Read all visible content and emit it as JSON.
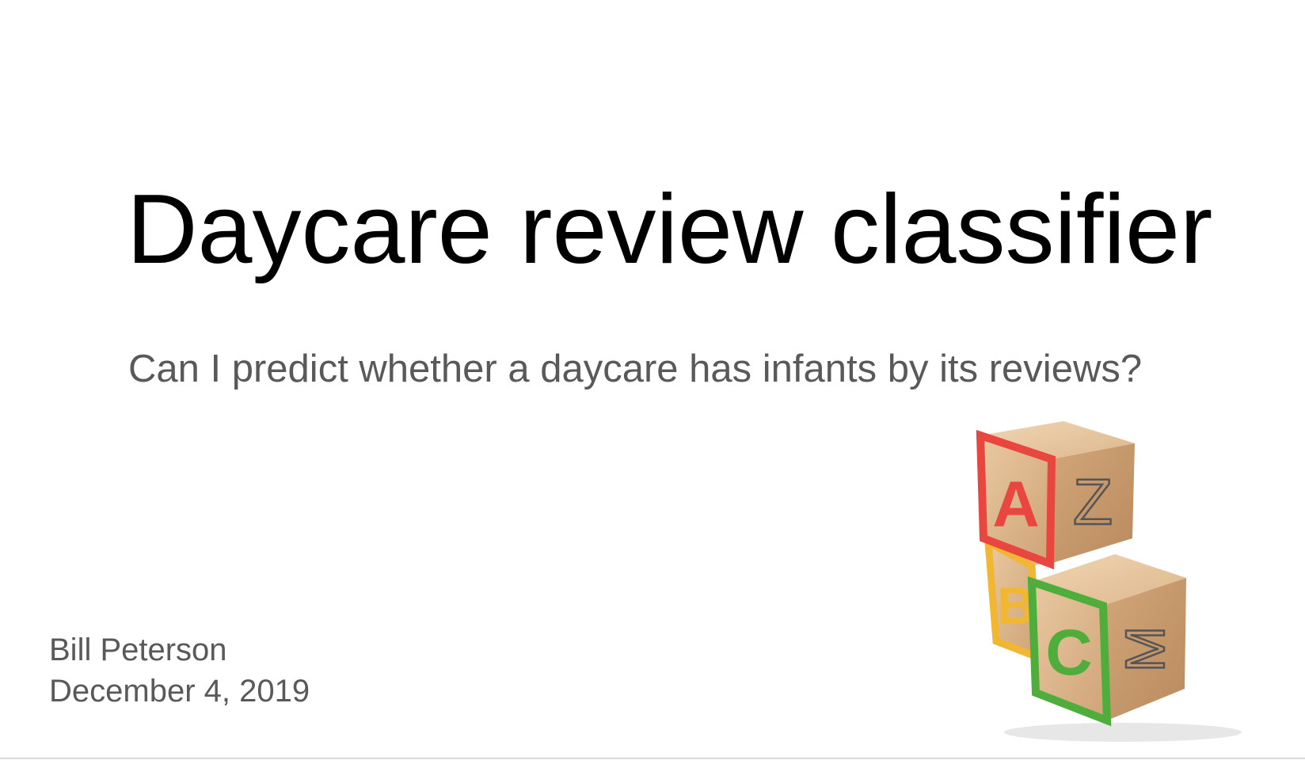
{
  "slide": {
    "title": "Daycare review classifier",
    "subtitle": "Can I predict whether a daycare has infants by its reviews?",
    "author": "Bill Peterson",
    "date": "December 4, 2019"
  },
  "image": {
    "icon": "abc-toy-blocks",
    "blocks": [
      {
        "letter": "A",
        "color": "#e8463f"
      },
      {
        "letter": "Z",
        "color": "#555555"
      },
      {
        "letter": "B",
        "color": "#f1b733"
      },
      {
        "letter": "C",
        "color": "#4fae3b"
      },
      {
        "letter": "M",
        "color": "#555555"
      }
    ]
  }
}
